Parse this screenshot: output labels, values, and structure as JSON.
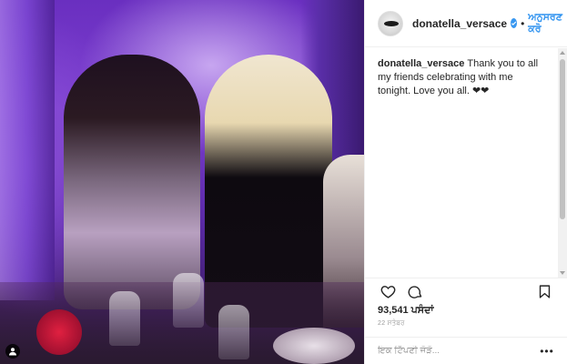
{
  "post": {
    "username": "donatella_versace",
    "follow_label": "ਅਨੁਸਰਣ ਕਰੋ",
    "separator": "•",
    "caption_user": "donatella_versace",
    "caption_text": "Thank you to all my friends celebrating with me tonight. Love you all. ❤❤",
    "likes": "93,541 ਪਸੰਦਾਂ",
    "time": "22 ਸਤੰਬਰ",
    "comment_placeholder": "ਇਕ ਟਿੱਪਣੀ ਜੋੜੋ...",
    "more_label": "•••"
  },
  "icons": {
    "user_tag": "user-tag-icon",
    "verified": "verified-badge-icon",
    "like": "heart-icon",
    "comment": "comment-icon",
    "save": "bookmark-icon",
    "scroll_up": "scroll-up-icon",
    "scroll_down": "scroll-down-icon"
  },
  "colors": {
    "accent": "#3897f0",
    "text": "#262626",
    "muted": "#999999",
    "border": "#efefef"
  }
}
